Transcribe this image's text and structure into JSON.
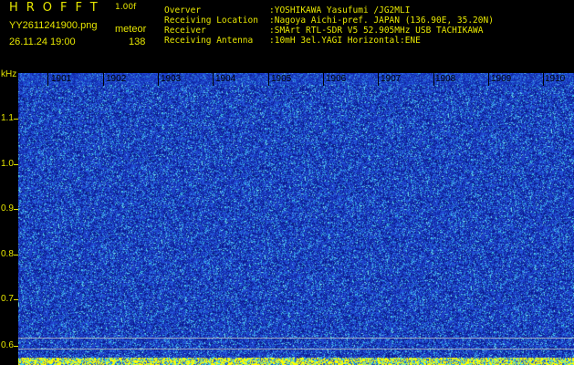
{
  "header": {
    "app_title": "HROFFT",
    "version": "1.00f",
    "filename": "YY2611241900.png",
    "meteor_label": "meteor",
    "datetime": "26.11.24 19:00",
    "meteor_count": "138"
  },
  "info": [
    {
      "key": "Overver",
      "value": ":YOSHIKAWA Yasufumi /JG2MLI"
    },
    {
      "key": "Receiving Location",
      "value": ":Nagoya Aichi-pref. JAPAN (136.90E, 35.20N)"
    },
    {
      "key": "Receiver",
      "value": ":SMArt RTL-SDR V5 52.905MHz USB TACHIKAWA"
    },
    {
      "key": "Receiving Antenna",
      "value": ":10mH 3el.YAGI Horizontal:ENE"
    }
  ],
  "axis": {
    "y_unit": "kHz",
    "y_ticks": [
      "1.1",
      "1.0",
      "0.9",
      "0.8",
      "0.7",
      "0.6"
    ],
    "x_ticks": [
      "1901",
      "1902",
      "1903",
      "1904",
      "1905",
      "1906",
      "1907",
      "1908",
      "1909",
      "1910"
    ]
  },
  "colors": {
    "label": "#e6e600",
    "background": "#000000",
    "spectrogram_base": "#1e3ec8",
    "spectrogram_dark": "#0a1a8a",
    "spectrogram_noise": "#3fd0e8",
    "bottom_band": "#ffff00"
  }
}
